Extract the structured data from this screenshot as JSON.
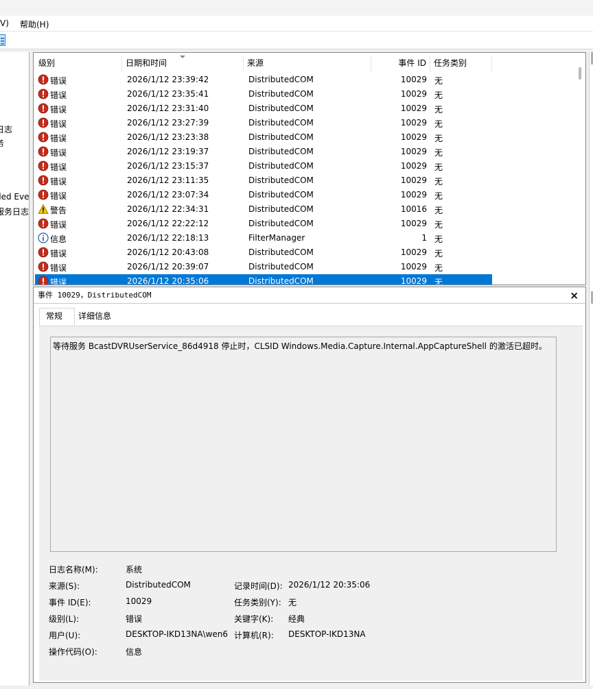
{
  "menu": {
    "view_partial": "V)",
    "help": "帮助(H)"
  },
  "tree": {
    "items": [
      "日志",
      "务",
      "ded Eve",
      "服务日志"
    ]
  },
  "columns": {
    "level": "级别",
    "date": "日期和时间",
    "source": "来源",
    "event_id": "事件 ID",
    "category": "任务类别"
  },
  "rows": [
    {
      "level": "错误",
      "icon": "error-icon",
      "date": "2026/1/12 23:39:42",
      "source": "DistributedCOM",
      "id": "10029",
      "category": "无"
    },
    {
      "level": "错误",
      "icon": "error-icon",
      "date": "2026/1/12 23:35:41",
      "source": "DistributedCOM",
      "id": "10029",
      "category": "无"
    },
    {
      "level": "错误",
      "icon": "error-icon",
      "date": "2026/1/12 23:31:40",
      "source": "DistributedCOM",
      "id": "10029",
      "category": "无"
    },
    {
      "level": "错误",
      "icon": "error-icon",
      "date": "2026/1/12 23:27:39",
      "source": "DistributedCOM",
      "id": "10029",
      "category": "无"
    },
    {
      "level": "错误",
      "icon": "error-icon",
      "date": "2026/1/12 23:23:38",
      "source": "DistributedCOM",
      "id": "10029",
      "category": "无"
    },
    {
      "level": "错误",
      "icon": "error-icon",
      "date": "2026/1/12 23:19:37",
      "source": "DistributedCOM",
      "id": "10029",
      "category": "无"
    },
    {
      "level": "错误",
      "icon": "error-icon",
      "date": "2026/1/12 23:15:37",
      "source": "DistributedCOM",
      "id": "10029",
      "category": "无"
    },
    {
      "level": "错误",
      "icon": "error-icon",
      "date": "2026/1/12 23:11:35",
      "source": "DistributedCOM",
      "id": "10029",
      "category": "无"
    },
    {
      "level": "错误",
      "icon": "error-icon",
      "date": "2026/1/12 23:07:34",
      "source": "DistributedCOM",
      "id": "10029",
      "category": "无"
    },
    {
      "level": "警告",
      "icon": "warning-icon",
      "date": "2026/1/12 22:34:31",
      "source": "DistributedCOM",
      "id": "10016",
      "category": "无"
    },
    {
      "level": "错误",
      "icon": "error-icon",
      "date": "2026/1/12 22:22:12",
      "source": "DistributedCOM",
      "id": "10029",
      "category": "无"
    },
    {
      "level": "信息",
      "icon": "info-icon",
      "date": "2026/1/12 22:18:13",
      "source": "FilterManager",
      "id": "1",
      "category": "无"
    },
    {
      "level": "错误",
      "icon": "error-icon",
      "date": "2026/1/12 20:43:08",
      "source": "DistributedCOM",
      "id": "10029",
      "category": "无"
    },
    {
      "level": "错误",
      "icon": "error-icon",
      "date": "2026/1/12 20:39:07",
      "source": "DistributedCOM",
      "id": "10029",
      "category": "无"
    },
    {
      "level": "错误",
      "icon": "error-icon",
      "date": "2026/1/12 20:35:06",
      "source": "DistributedCOM",
      "id": "10029",
      "category": "无",
      "selected": true
    }
  ],
  "detail": {
    "title": "事件 10029，DistributedCOM",
    "close": "×",
    "tabs": [
      "常规",
      "详细信息"
    ],
    "description": "等待服务 BcastDVRUserService_86d4918 停止时，CLSID Windows.Media.Capture.Internal.AppCaptureShell 的激活已超时。",
    "props": {
      "log_name_label": "日志名称(M):",
      "log_name": "系统",
      "source_label": "来源(S):",
      "source": "DistributedCOM",
      "logged_label": "记录时间(D):",
      "logged": "2026/1/12 20:35:06",
      "event_id_label": "事件 ID(E):",
      "event_id": "10029",
      "task_label": "任务类别(Y):",
      "task": "无",
      "level_label": "级别(L):",
      "level": "错误",
      "keywords_label": "关键字(K):",
      "keywords": "经典",
      "user_label": "用户(U):",
      "user": "DESKTOP-IKD13NA\\wen6",
      "computer_label": "计算机(R):",
      "computer": "DESKTOP-IKD13NA",
      "opcode_label": "操作代码(O):",
      "opcode": "信息"
    }
  },
  "colors": {
    "error": "#c42b1c",
    "warning": "#f4c400",
    "info": "#1f5fa8",
    "selection": "#0078d7"
  }
}
